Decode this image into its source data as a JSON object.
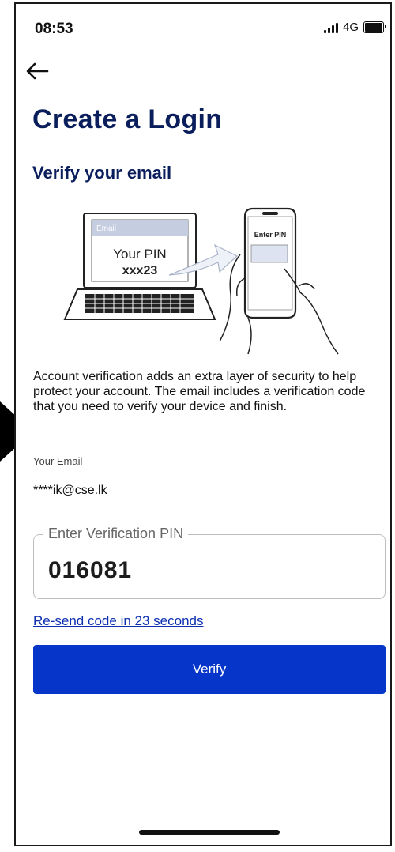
{
  "status_bar": {
    "time": "08:53",
    "network": "4G"
  },
  "header": {
    "title": "Create a Login",
    "subtitle": "Verify your email"
  },
  "illustration": {
    "laptop_header": "Email",
    "laptop_line1": "Your PIN",
    "laptop_line2": "xxx23",
    "phone_label": "Enter PIN"
  },
  "description": "Account verification adds an extra layer of security to help protect your account. The email includes a verification code that you need to verify your device and finish.",
  "email": {
    "label": "Your Email",
    "value": "****ik@cse.lk"
  },
  "pin_field": {
    "label": "Enter Verification PIN",
    "value": "016081"
  },
  "resend_link": "Re-send code in 23 seconds",
  "verify_button": "Verify",
  "colors": {
    "brand_navy": "#0a1e5c",
    "button_blue": "#0635c9",
    "link_blue": "#0d2fb0"
  }
}
